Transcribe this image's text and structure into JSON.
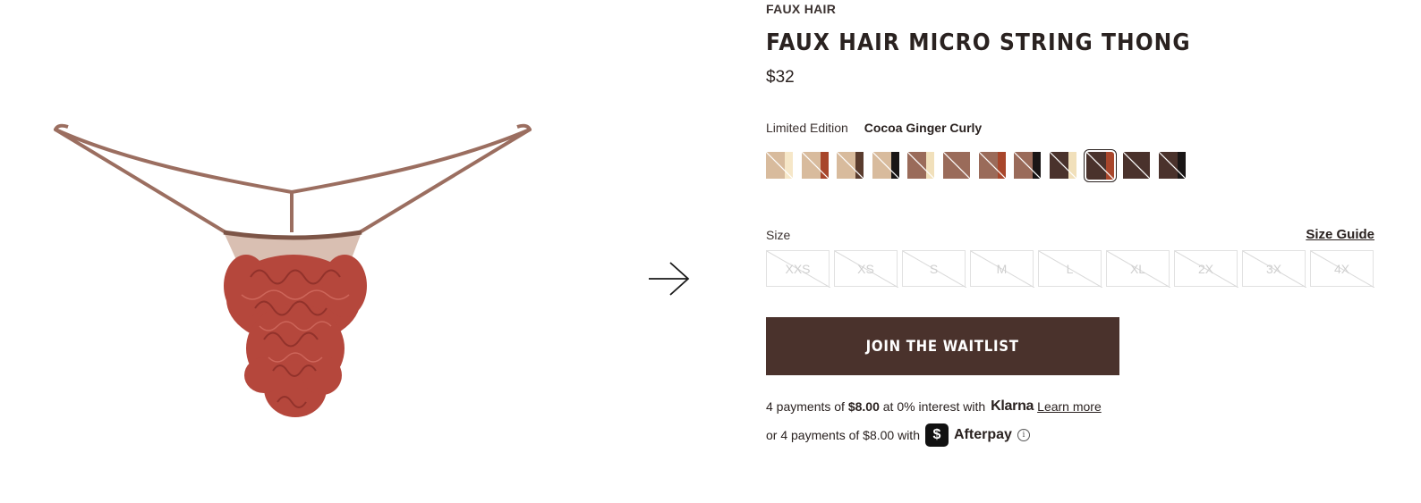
{
  "product": {
    "collection": "FAUX HAIR",
    "title": "FAUX HAIR MICRO STRING THONG",
    "price": "$32",
    "image_alt": "Faux hair micro string thong in cocoa ginger curly"
  },
  "color": {
    "label": "Limited Edition",
    "selected": "Cocoa Ginger Curly",
    "swatches": [
      {
        "left": "#d8bb9d",
        "right": "#f6e7c8",
        "selected": false
      },
      {
        "left": "#d8bb9d",
        "right": "#a8462b",
        "selected": false
      },
      {
        "left": "#d8bb9d",
        "right": "#5a3c2e",
        "selected": false
      },
      {
        "left": "#d8bb9d",
        "right": "#1a1616",
        "selected": false
      },
      {
        "left": "#9a6b5a",
        "right": "#f1e0bb",
        "selected": false
      },
      {
        "left": "#9a6b5a",
        "right": "#9a6b5a",
        "selected": false
      },
      {
        "left": "#9a6b5a",
        "right": "#a8462b",
        "selected": false
      },
      {
        "left": "#9a6b5a",
        "right": "#1a1616",
        "selected": false
      },
      {
        "left": "#4a322c",
        "right": "#f1e0bb",
        "selected": false
      },
      {
        "left": "#4a322c",
        "right": "#a8462b",
        "selected": true
      },
      {
        "left": "#4a322c",
        "right": "#4a322c",
        "selected": false
      },
      {
        "left": "#4a322c",
        "right": "#1a1616",
        "selected": false
      }
    ]
  },
  "size": {
    "label": "Size",
    "guide": "Size Guide",
    "options": [
      "XXS",
      "XS",
      "S",
      "M",
      "L",
      "XL",
      "2X",
      "3X",
      "4X"
    ]
  },
  "cta": {
    "waitlist": "JOIN THE WAITLIST"
  },
  "klarna": {
    "prefix": "4 payments of ",
    "amount": "$8.00",
    "suffix": " at 0% interest with",
    "brand": "Klarna",
    "learn_more": "Learn more"
  },
  "afterpay": {
    "text": "or 4 payments of $8.00 with",
    "brand": "Afterpay"
  },
  "colors": {
    "accent": "#4a322c",
    "thong_strap": "#9b6e60",
    "hair": "#b5473c"
  }
}
